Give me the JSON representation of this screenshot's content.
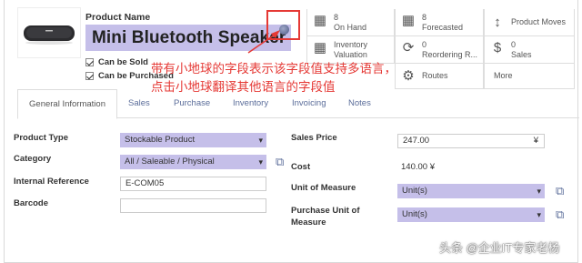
{
  "product": {
    "name_label": "Product Name",
    "name_value": "Mini Bluetooth Speaker",
    "can_be_sold": "Can be Sold",
    "can_be_purchased": "Can be Purchased"
  },
  "stats": {
    "on_hand_count": "8",
    "on_hand_label": "On Hand",
    "forecasted_count": "8",
    "forecasted_label": "Forecasted",
    "product_moves": "Product Moves",
    "inventory_valuation_1": "Inventory",
    "inventory_valuation_2": "Valuation",
    "reordering_count": "0",
    "reordering_label": "Reordering R...",
    "sales_count": "0",
    "sales_label": "Sales",
    "routes_label": "Routes",
    "more_label": "More"
  },
  "annotation": {
    "line1": "带有小地球的字段表示该字段值支持多语言，",
    "line2": "点击小地球翻译其他语言的字段值"
  },
  "tabs": [
    "General Information",
    "Sales",
    "Purchase",
    "Inventory",
    "Invoicing",
    "Notes"
  ],
  "form": {
    "product_type_label": "Product Type",
    "product_type_value": "Stockable Product",
    "category_label": "Category",
    "category_value": "All / Saleable / Physical",
    "internal_ref_label": "Internal Reference",
    "internal_ref_value": "E-COM05",
    "barcode_label": "Barcode",
    "barcode_value": "",
    "sales_price_label": "Sales Price",
    "sales_price_value": "247.00",
    "currency": "¥",
    "cost_label": "Cost",
    "cost_value": "140.00 ¥",
    "uom_label": "Unit of Measure",
    "uom_value": "Unit(s)",
    "purchase_uom_label_1": "Purchase Unit of",
    "purchase_uom_label_2": "Measure",
    "purchase_uom_value": "Unit(s)"
  },
  "watermark": "头条 @企业IT专家老杨",
  "colors": {
    "select_bg": "#c5bfe9",
    "annotation": "#e53935",
    "tab_link": "#5b6d9a"
  }
}
